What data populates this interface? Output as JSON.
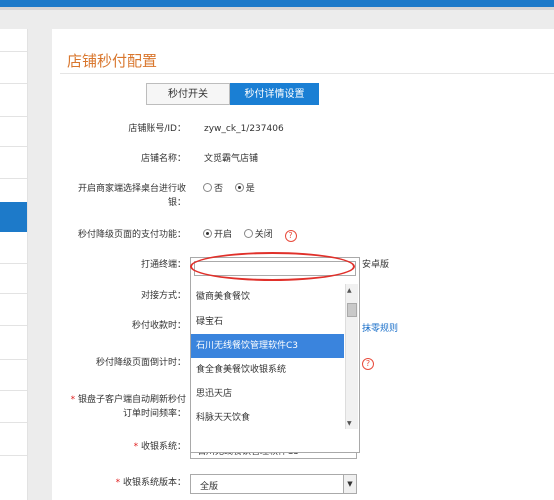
{
  "page": {
    "title": "店铺秒付配置"
  },
  "tabs": [
    "秒付开关",
    "秒付详情设置"
  ],
  "fields": {
    "account_label": "店铺账号/ID：",
    "account_value": "zyw_ck_1/237406",
    "store_label": "店铺名称：",
    "store_value": "文觅霸气店铺",
    "table_select_label_1": "开启商家端选择桌台进行收",
    "table_select_label_2": "银：",
    "radio_no": "否",
    "radio_yes": "是",
    "downgrade_label": "秒付降级页面的支付功能：",
    "radio_on": "开启",
    "radio_off": "关闭",
    "terminal_label": "打通终端：",
    "terminal_side_text": "安卓版",
    "connect_label": "对接方式：",
    "cashier_label": "秒付收款时：",
    "cashier_link": "抹零规则",
    "countdown_label": "秒付降级页面倒计时：",
    "refresh_label_1": "银盘子客户端自动刷新秒付",
    "refresh_label_2": "订单时间频率：",
    "cashier_system_label": "收银系统：",
    "cashier_system_value": "石川无线餐饮管理软件C3",
    "version_label": "收银系统版本：",
    "version_value": "全版"
  },
  "dropdown": {
    "options": [
      "徽商美食餐饮",
      "碌宝石",
      "石川无线餐饮管理软件C3",
      "食全食美餐饮收银系统",
      "思迅天店",
      "科脉天天饮食"
    ],
    "selected_index": 2
  },
  "icons": {
    "help": "question-circle-icon",
    "clear": "clear-x-icon",
    "arrow_down": "triangle-down-icon",
    "arrow_up": "triangle-up-icon"
  },
  "colors": {
    "accent": "#1d7ac9",
    "title": "#d9772e",
    "highlight": "#3a84dd",
    "annotation": "#e0302a"
  }
}
